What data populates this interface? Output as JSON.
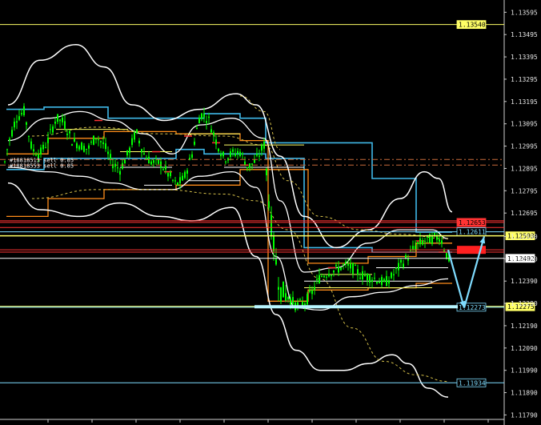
{
  "chart_data": {
    "type": "candlestick",
    "instrument_note": "",
    "ylim": [
      1.1177,
      1.1365
    ],
    "y_ticks": [
      "1.13595",
      "1.13495",
      "1.13395",
      "1.13295",
      "1.13195",
      "1.13095",
      "1.12995",
      "1.12895",
      "1.12795",
      "1.12695",
      "1.12590",
      "1.12490",
      "1.12390",
      "1.12290",
      "1.12190",
      "1.12090",
      "1.11990",
      "1.11890",
      "1.11790"
    ],
    "grid": false,
    "background_color": "#000000",
    "colors": {
      "bull": "#00ff00",
      "bear": "#00ff00",
      "bands": "#ffffff",
      "envelope": "#3fb8e8",
      "orange_channel": "#ff8c1a",
      "yellow_levels": "#ffff66",
      "red_levels": "#ff3333",
      "forecast_arrow": "#7fdcff",
      "support_zone": "#b8f5ff"
    },
    "horizontal_levels": [
      {
        "label": "1.13540",
        "value": 1.1354,
        "color": "#ffff66"
      },
      {
        "label": "1.12653",
        "value": 1.12653,
        "color": "#ff3333"
      },
      {
        "label": "1.12611",
        "value": 1.12611,
        "color": "#7fdcff"
      },
      {
        "label": "1.12593",
        "value": 1.12593,
        "color": "#ffff66"
      },
      {
        "label": "1.12492",
        "value": 1.12492,
        "color": "#ffffff"
      },
      {
        "label": "1.12275",
        "value": 1.12275,
        "color": "#ffff66"
      },
      {
        "label": "1.12273",
        "value": 1.12273,
        "color": "#7fdcff"
      },
      {
        "label": "1.11934",
        "value": 1.11934,
        "color": "#7fdcff"
      }
    ],
    "current_price": {
      "label": "1.12492",
      "value": 1.12492
    },
    "red_marker_price": {
      "value": 1.1253
    },
    "order_labels": [
      "#18818513 sell 0.05",
      "#18818553 sell 0.05"
    ],
    "order_lines": [
      1.12935,
      1.1291
    ],
    "price_series": {
      "description": "close path estimate",
      "points": [
        [
          0,
          1.1281
        ],
        [
          10,
          1.13
        ],
        [
          20,
          1.1312
        ],
        [
          30,
          1.1315
        ],
        [
          40,
          1.1298
        ],
        [
          50,
          1.1296
        ],
        [
          60,
          1.1302
        ],
        [
          70,
          1.1312
        ],
        [
          80,
          1.131
        ],
        [
          90,
          1.1302
        ],
        [
          100,
          1.13
        ],
        [
          110,
          1.1298
        ],
        [
          120,
          1.1304
        ],
        [
          130,
          1.13
        ],
        [
          140,
          1.1292
        ],
        [
          150,
          1.1289
        ],
        [
          160,
          1.1296
        ],
        [
          170,
          1.1306
        ],
        [
          180,
          1.1296
        ],
        [
          190,
          1.1292
        ],
        [
          200,
          1.1292
        ],
        [
          210,
          1.1287
        ],
        [
          220,
          1.1282
        ],
        [
          230,
          1.1285
        ],
        [
          240,
          1.1296
        ],
        [
          250,
          1.1314
        ],
        [
          260,
          1.1312
        ],
        [
          270,
          1.1302
        ],
        [
          280,
          1.1294
        ],
        [
          290,
          1.1296
        ],
        [
          300,
          1.1297
        ],
        [
          310,
          1.129
        ],
        [
          320,
          1.1293
        ],
        [
          330,
          1.13
        ],
        [
          340,
          1.126
        ],
        [
          350,
          1.1235
        ],
        [
          360,
          1.1232
        ],
        [
          370,
          1.1228
        ],
        [
          380,
          1.1229
        ],
        [
          390,
          1.1234
        ],
        [
          400,
          1.1241
        ],
        [
          410,
          1.1243
        ],
        [
          420,
          1.1244
        ],
        [
          430,
          1.1246
        ],
        [
          440,
          1.1245
        ],
        [
          450,
          1.1242
        ],
        [
          460,
          1.1241
        ],
        [
          470,
          1.124
        ],
        [
          480,
          1.1238
        ],
        [
          490,
          1.1241
        ],
        [
          500,
          1.1246
        ],
        [
          510,
          1.125
        ],
        [
          520,
          1.1255
        ],
        [
          530,
          1.1257
        ],
        [
          540,
          1.1258
        ],
        [
          550,
          1.1259
        ],
        [
          560,
          1.1249
        ]
      ]
    },
    "forecast": {
      "points": [
        [
          560,
          1.1253
        ],
        [
          580,
          1.1227
        ],
        [
          605,
          1.1259
        ]
      ]
    }
  }
}
